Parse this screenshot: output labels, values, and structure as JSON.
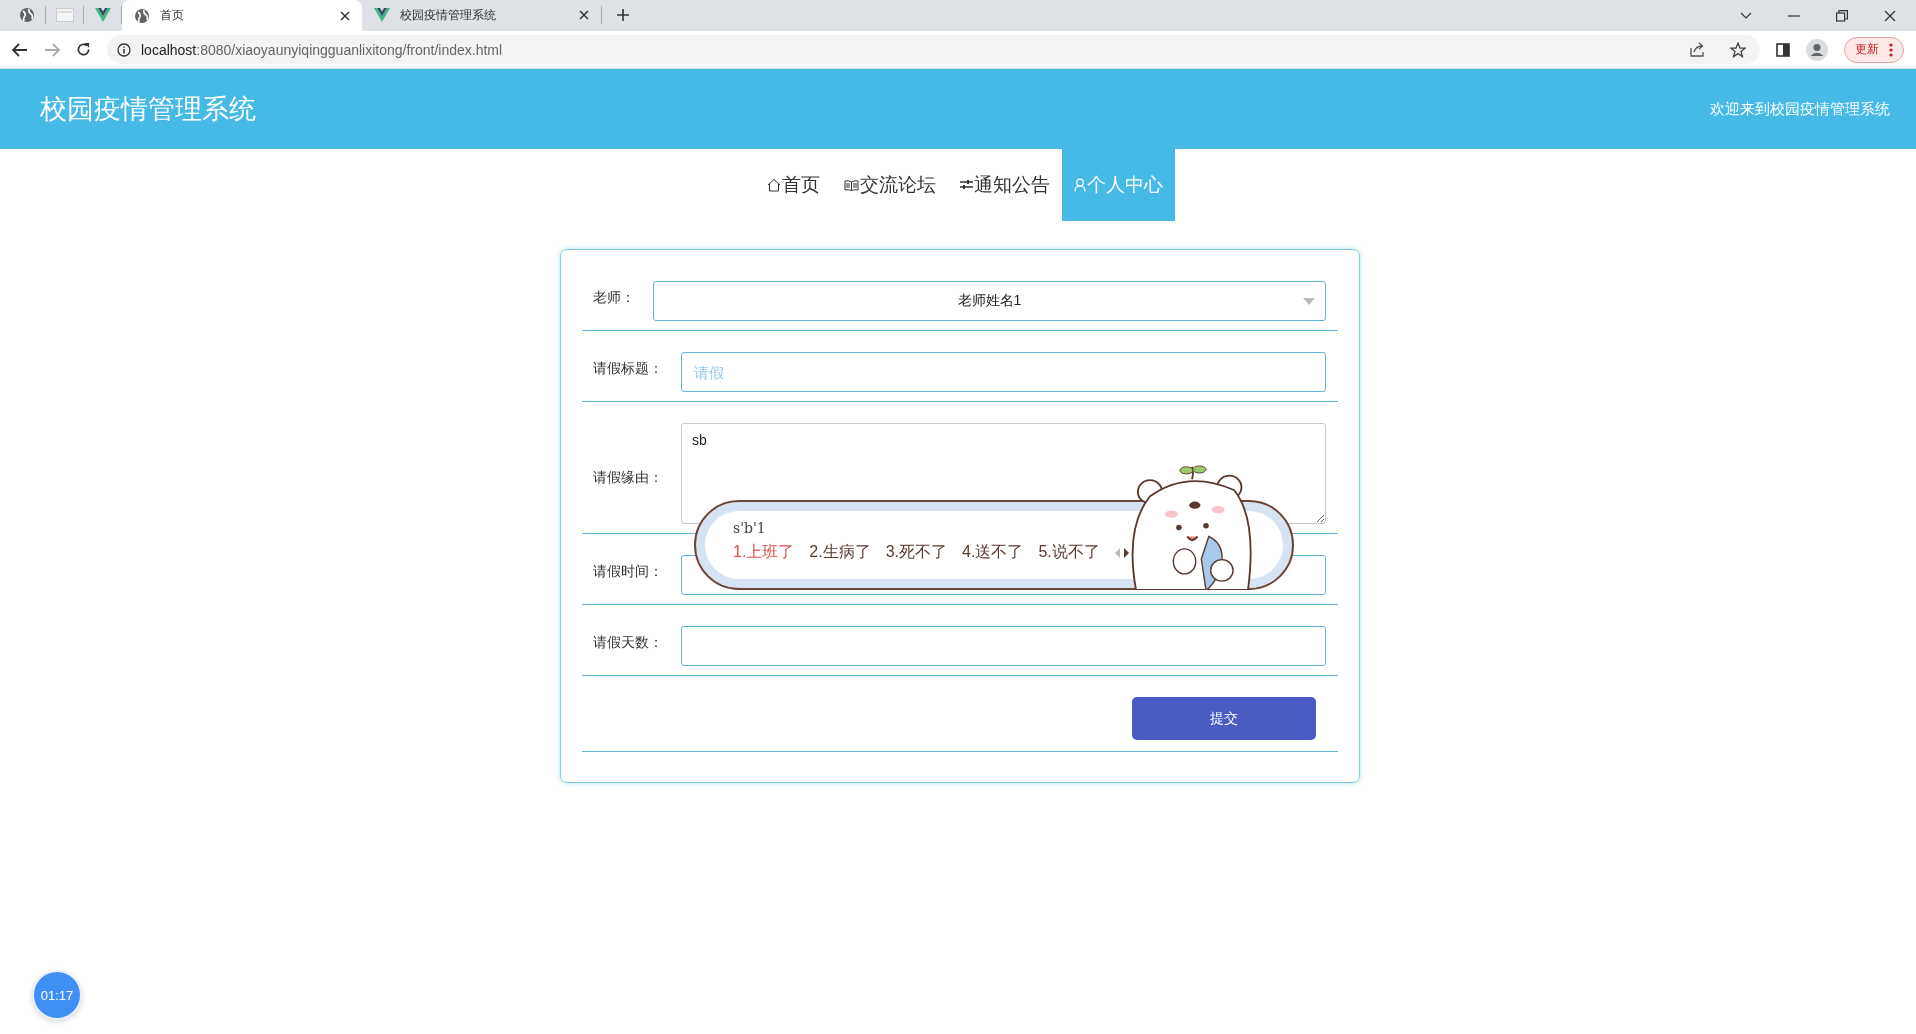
{
  "browser": {
    "tabs": [
      {
        "kind": "globe",
        "selected": false
      },
      {
        "kind": "blank",
        "selected": false
      },
      {
        "kind": "vue",
        "selected": false
      },
      {
        "kind": "globe",
        "title": "首页",
        "selected": true
      },
      {
        "kind": "vue",
        "title": "校园疫情管理系统",
        "selected": false
      }
    ],
    "url_host": "localhost",
    "url_rest": ":8080/xiaoyaunyiqingguanlixitong/front/index.html",
    "update_button": "更新"
  },
  "header": {
    "title": "校园疫情管理系统",
    "welcome": "欢迎来到校园疫情管理系统"
  },
  "nav": [
    {
      "kind": "home",
      "label": "首页",
      "selected": false
    },
    {
      "kind": "book",
      "label": "交流论坛",
      "selected": false
    },
    {
      "kind": "sliders",
      "label": "通知公告",
      "selected": false
    },
    {
      "kind": "person",
      "label": "个人中心",
      "selected": true
    }
  ],
  "form": {
    "fields": [
      {
        "kind": "select",
        "label": "老师：",
        "value": "老师姓名1"
      },
      {
        "kind": "input",
        "label": "请假标题：",
        "placeholder": "请假"
      },
      {
        "kind": "textarea",
        "label": "请假缘由：",
        "value": "sb"
      },
      {
        "kind": "input",
        "label": "请假时间："
      },
      {
        "kind": "input",
        "label": "请假天数："
      }
    ],
    "submit": "提交"
  },
  "ime": {
    "composition": "s'b'1",
    "candidates": [
      {
        "text": "1.上班了",
        "selected": true
      },
      {
        "text": "2.生病了",
        "selected": false
      },
      {
        "text": "3.死不了",
        "selected": false
      },
      {
        "text": "4.送不了",
        "selected": false
      },
      {
        "text": "5.说不了",
        "selected": false
      }
    ]
  },
  "timer": "01:17"
}
